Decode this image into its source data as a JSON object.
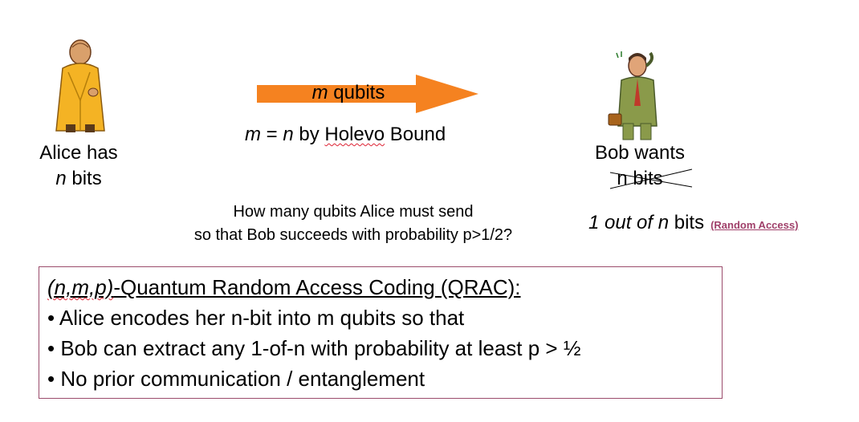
{
  "alice": {
    "line1": "Alice has",
    "n": "n",
    "line2": " bits"
  },
  "arrow": {
    "m": "m",
    "label": " qubits",
    "color": "#f58220"
  },
  "holevo": {
    "m": "m",
    "eq": " = ",
    "n": "n",
    "by": " by ",
    "holevo": "Holevo",
    "bound": " Bound"
  },
  "bob": {
    "line1": "Bob wants",
    "bits": "n bits"
  },
  "question": {
    "line1": "How many qubits Alice must send",
    "line2": "so that Bob succeeds with probability p>1/2?"
  },
  "access": {
    "prefix": "1 out of n",
    "suffix": " bits",
    "link": "(Random Access)"
  },
  "qrac": {
    "title_italic": "(n,m,p)",
    "title_rest": "-Quantum Random Access Coding (QRAC):",
    "bullets": [
      "• Alice encodes her n-bit into m qubits so that",
      "• Bob can extract any 1-of-n with probability at least p > ½",
      "• No prior communication / entanglement"
    ]
  },
  "colors": {
    "arrow": "#f58220",
    "box_border": "#9b4c6c",
    "link": "#a0406a"
  }
}
